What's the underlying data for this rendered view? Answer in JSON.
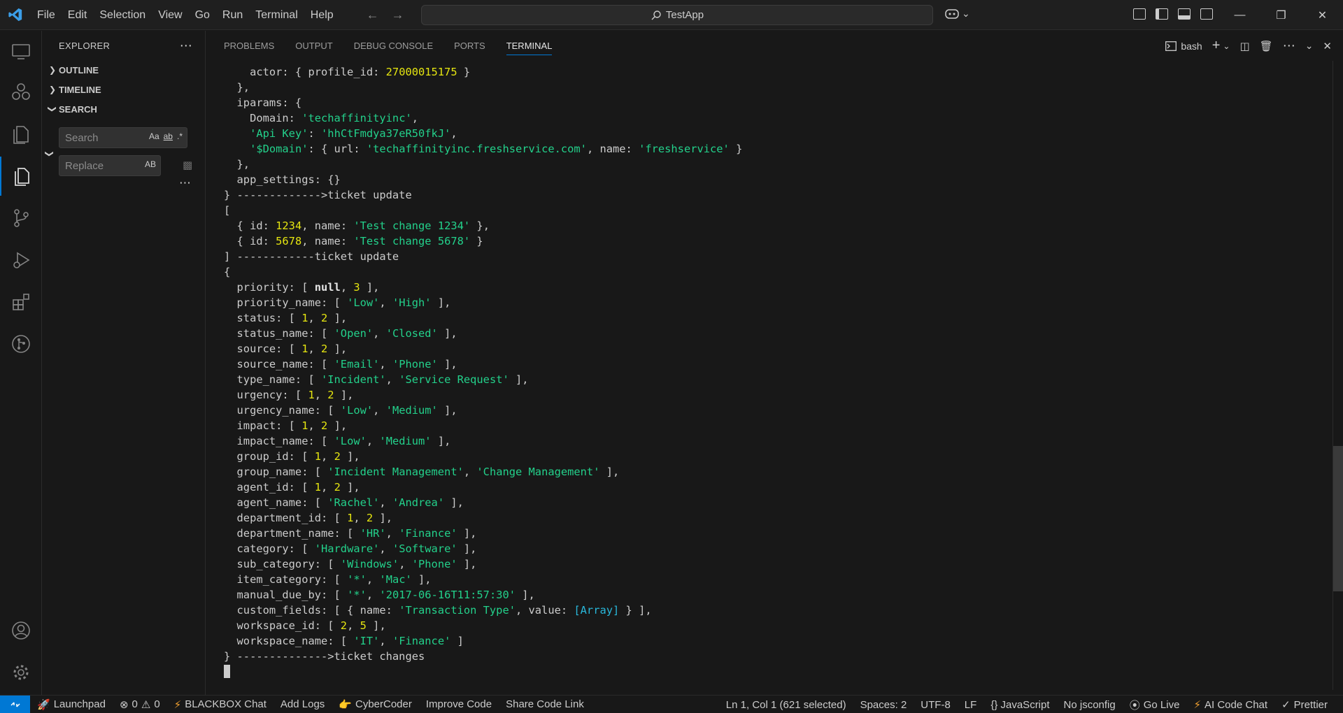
{
  "titlebar": {
    "menu": [
      "File",
      "Edit",
      "Selection",
      "View",
      "Go",
      "Run",
      "Terminal",
      "Help"
    ],
    "search_text": "TestApp"
  },
  "activity_bar": {
    "items": [
      "remote-explorer-icon",
      "extensions-alt-icon",
      "explorer-icon",
      "files-icon",
      "source-control-icon",
      "run-debug-icon",
      "extensions-icon",
      "git-graph-icon"
    ],
    "bottom": [
      "accounts-icon",
      "settings-icon"
    ]
  },
  "sidebar": {
    "title": "EXPLORER",
    "sections": [
      "OUTLINE",
      "TIMELINE",
      "SEARCH"
    ],
    "search_placeholder": "Search",
    "replace_placeholder": "Replace",
    "search_opts": [
      "Aa",
      "ab",
      ".*"
    ],
    "replace_opt": "AB"
  },
  "panel": {
    "tabs": [
      "PROBLEMS",
      "OUTPUT",
      "DEBUG CONSOLE",
      "PORTS",
      "TERMINAL"
    ],
    "active_tab": "TERMINAL",
    "shell": "bash"
  },
  "terminal": {
    "lines": [
      [
        [
          "    actor: { profile_id: ",
          ""
        ],
        [
          "27000015175",
          "n"
        ],
        [
          " }",
          ""
        ]
      ],
      [
        [
          "  },",
          ""
        ]
      ],
      [
        [
          "  iparams: {",
          ""
        ]
      ],
      [
        [
          "    Domain: ",
          ""
        ],
        [
          "'techaffinityinc'",
          "s"
        ],
        [
          ",",
          ""
        ]
      ],
      [
        [
          "    ",
          ""
        ],
        [
          "'Api Key'",
          "s"
        ],
        [
          ": ",
          ""
        ],
        [
          "'hhCtFmdya37eR50fkJ'",
          "s"
        ],
        [
          ",",
          ""
        ]
      ],
      [
        [
          "    ",
          ""
        ],
        [
          "'$Domain'",
          "s"
        ],
        [
          ": { url: ",
          ""
        ],
        [
          "'techaffinityinc.freshservice.com'",
          "s"
        ],
        [
          ", name: ",
          ""
        ],
        [
          "'freshservice'",
          "s"
        ],
        [
          " }",
          ""
        ]
      ],
      [
        [
          "  },",
          ""
        ]
      ],
      [
        [
          "  app_settings: {}",
          ""
        ]
      ],
      [
        [
          "} ------------->ticket update",
          ""
        ]
      ],
      [
        [
          "[",
          ""
        ]
      ],
      [
        [
          "  { id: ",
          ""
        ],
        [
          "1234",
          "n"
        ],
        [
          ", name: ",
          ""
        ],
        [
          "'Test change 1234'",
          "s"
        ],
        [
          " },",
          ""
        ]
      ],
      [
        [
          "  { id: ",
          ""
        ],
        [
          "5678",
          "n"
        ],
        [
          ", name: ",
          ""
        ],
        [
          "'Test change 5678'",
          "s"
        ],
        [
          " }",
          ""
        ]
      ],
      [
        [
          "] ------------ticket update",
          ""
        ]
      ],
      [
        [
          "{",
          ""
        ]
      ],
      [
        [
          "  priority: [ ",
          ""
        ],
        [
          "null",
          "b"
        ],
        [
          ", ",
          ""
        ],
        [
          "3",
          "n"
        ],
        [
          " ],",
          ""
        ]
      ],
      [
        [
          "  priority_name: [ ",
          ""
        ],
        [
          "'Low'",
          "s"
        ],
        [
          ", ",
          ""
        ],
        [
          "'High'",
          "s"
        ],
        [
          " ],",
          ""
        ]
      ],
      [
        [
          "  status: [ ",
          ""
        ],
        [
          "1",
          "n"
        ],
        [
          ", ",
          ""
        ],
        [
          "2",
          "n"
        ],
        [
          " ],",
          ""
        ]
      ],
      [
        [
          "  status_name: [ ",
          ""
        ],
        [
          "'Open'",
          "s"
        ],
        [
          ", ",
          ""
        ],
        [
          "'Closed'",
          "s"
        ],
        [
          " ],",
          ""
        ]
      ],
      [
        [
          "  source: [ ",
          ""
        ],
        [
          "1",
          "n"
        ],
        [
          ", ",
          ""
        ],
        [
          "2",
          "n"
        ],
        [
          " ],",
          ""
        ]
      ],
      [
        [
          "  source_name: [ ",
          ""
        ],
        [
          "'Email'",
          "s"
        ],
        [
          ", ",
          ""
        ],
        [
          "'Phone'",
          "s"
        ],
        [
          " ],",
          ""
        ]
      ],
      [
        [
          "  type_name: [ ",
          ""
        ],
        [
          "'Incident'",
          "s"
        ],
        [
          ", ",
          ""
        ],
        [
          "'Service Request'",
          "s"
        ],
        [
          " ],",
          ""
        ]
      ],
      [
        [
          "  urgency: [ ",
          ""
        ],
        [
          "1",
          "n"
        ],
        [
          ", ",
          ""
        ],
        [
          "2",
          "n"
        ],
        [
          " ],",
          ""
        ]
      ],
      [
        [
          "  urgency_name: [ ",
          ""
        ],
        [
          "'Low'",
          "s"
        ],
        [
          ", ",
          ""
        ],
        [
          "'Medium'",
          "s"
        ],
        [
          " ],",
          ""
        ]
      ],
      [
        [
          "  impact: [ ",
          ""
        ],
        [
          "1",
          "n"
        ],
        [
          ", ",
          ""
        ],
        [
          "2",
          "n"
        ],
        [
          " ],",
          ""
        ]
      ],
      [
        [
          "  impact_name: [ ",
          ""
        ],
        [
          "'Low'",
          "s"
        ],
        [
          ", ",
          ""
        ],
        [
          "'Medium'",
          "s"
        ],
        [
          " ],",
          ""
        ]
      ],
      [
        [
          "  group_id: [ ",
          ""
        ],
        [
          "1",
          "n"
        ],
        [
          ", ",
          ""
        ],
        [
          "2",
          "n"
        ],
        [
          " ],",
          ""
        ]
      ],
      [
        [
          "  group_name: [ ",
          ""
        ],
        [
          "'Incident Management'",
          "s"
        ],
        [
          ", ",
          ""
        ],
        [
          "'Change Management'",
          "s"
        ],
        [
          " ],",
          ""
        ]
      ],
      [
        [
          "  agent_id: [ ",
          ""
        ],
        [
          "1",
          "n"
        ],
        [
          ", ",
          ""
        ],
        [
          "2",
          "n"
        ],
        [
          " ],",
          ""
        ]
      ],
      [
        [
          "  agent_name: [ ",
          ""
        ],
        [
          "'Rachel'",
          "s"
        ],
        [
          ", ",
          ""
        ],
        [
          "'Andrea'",
          "s"
        ],
        [
          " ],",
          ""
        ]
      ],
      [
        [
          "  department_id: [ ",
          ""
        ],
        [
          "1",
          "n"
        ],
        [
          ", ",
          ""
        ],
        [
          "2",
          "n"
        ],
        [
          " ],",
          ""
        ]
      ],
      [
        [
          "  department_name: [ ",
          ""
        ],
        [
          "'HR'",
          "s"
        ],
        [
          ", ",
          ""
        ],
        [
          "'Finance'",
          "s"
        ],
        [
          " ],",
          ""
        ]
      ],
      [
        [
          "  category: [ ",
          ""
        ],
        [
          "'Hardware'",
          "s"
        ],
        [
          ", ",
          ""
        ],
        [
          "'Software'",
          "s"
        ],
        [
          " ],",
          ""
        ]
      ],
      [
        [
          "  sub_category: [ ",
          ""
        ],
        [
          "'Windows'",
          "s"
        ],
        [
          ", ",
          ""
        ],
        [
          "'Phone'",
          "s"
        ],
        [
          " ],",
          ""
        ]
      ],
      [
        [
          "  item_category: [ ",
          ""
        ],
        [
          "'*'",
          "s"
        ],
        [
          ", ",
          ""
        ],
        [
          "'Mac'",
          "s"
        ],
        [
          " ],",
          ""
        ]
      ],
      [
        [
          "  manual_due_by: [ ",
          ""
        ],
        [
          "'*'",
          "s"
        ],
        [
          ", ",
          ""
        ],
        [
          "'2017-06-16T11:57:30'",
          "s"
        ],
        [
          " ],",
          ""
        ]
      ],
      [
        [
          "  custom_fields: [ { name: ",
          ""
        ],
        [
          "'Transaction Type'",
          "s"
        ],
        [
          ", value: ",
          ""
        ],
        [
          "[Array]",
          "c"
        ],
        [
          " } ],",
          ""
        ]
      ],
      [
        [
          "  workspace_id: [ ",
          ""
        ],
        [
          "2",
          "n"
        ],
        [
          ", ",
          ""
        ],
        [
          "5",
          "n"
        ],
        [
          " ],",
          ""
        ]
      ],
      [
        [
          "  workspace_name: [ ",
          ""
        ],
        [
          "'IT'",
          "s"
        ],
        [
          ", ",
          ""
        ],
        [
          "'Finance'",
          "s"
        ],
        [
          " ]",
          ""
        ]
      ],
      [
        [
          "} -------------->ticket changes",
          ""
        ]
      ]
    ]
  },
  "statusbar": {
    "left": [
      "Launchpad",
      "0",
      "0",
      "BLACKBOX Chat",
      "Add Logs",
      "CyberCoder",
      "Improve Code",
      "Share Code Link"
    ],
    "right": [
      "Ln 1, Col 1 (621 selected)",
      "Spaces: 2",
      "UTF-8",
      "LF",
      "{} JavaScript",
      "No jsconfig",
      "Go Live",
      "AI Code Chat",
      "Prettier"
    ]
  },
  "colors": {
    "accent": "#0078d4",
    "string": "#23d18b",
    "number": "#e5e510",
    "special": "#29b8db"
  }
}
